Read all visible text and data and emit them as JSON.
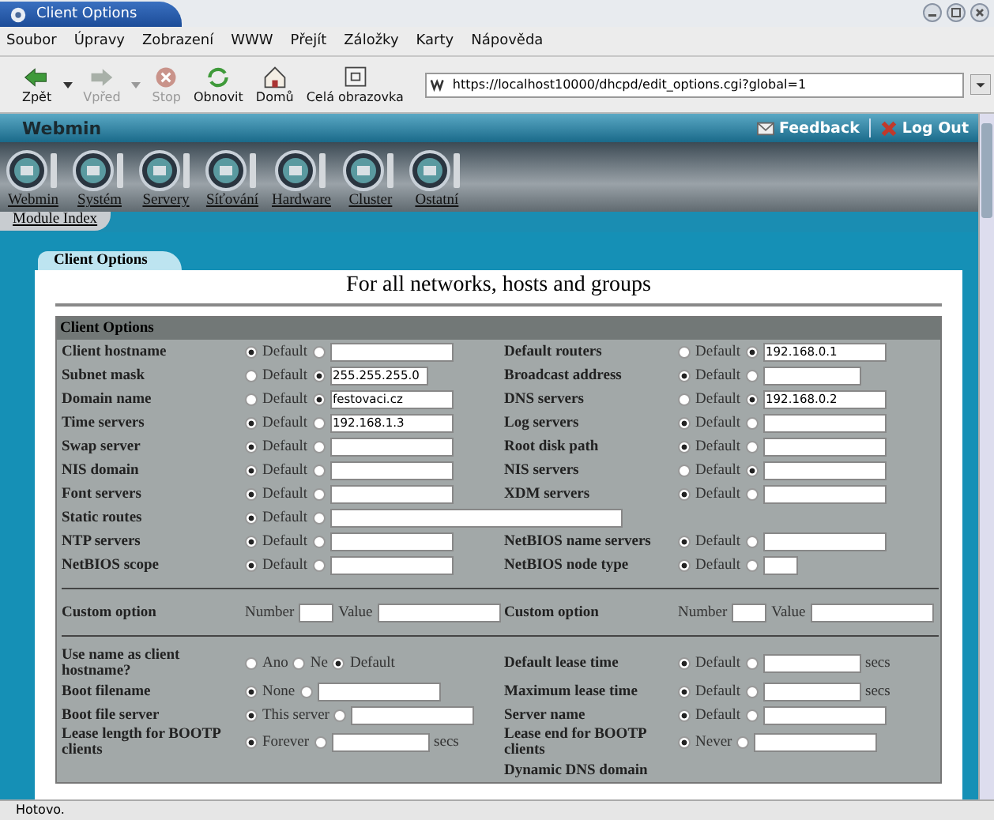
{
  "window": {
    "title": "Client Options"
  },
  "menu": [
    "Soubor",
    "Úpravy",
    "Zobrazení",
    "WWW",
    "Přejít",
    "Záložky",
    "Karty",
    "Nápověda"
  ],
  "toolbar": [
    {
      "label": "Zpět",
      "disabled": false,
      "dropdown": true
    },
    {
      "label": "Vpřed",
      "disabled": true,
      "dropdown": true
    },
    {
      "label": "Stop",
      "disabled": true,
      "dropdown": false
    },
    {
      "label": "Obnovit",
      "disabled": false,
      "dropdown": false
    },
    {
      "label": "Domů",
      "disabled": false,
      "dropdown": false
    },
    {
      "label": "Celá obrazovka",
      "disabled": false,
      "dropdown": false
    }
  ],
  "address": {
    "value": "https://localhost10000/dhcpd/edit_options.cgi?global=1"
  },
  "webmin": {
    "title": "Webmin",
    "feedback": "Feedback",
    "logout": "Log Out"
  },
  "categories": [
    "Webmin",
    "Systém",
    "Servery",
    "Síťování",
    "Hardware",
    "Cluster",
    "Ostatní"
  ],
  "module_index": "Module Index",
  "tab": "Client Options",
  "heading": "For all networks, hosts and groups",
  "section_title": "Client Options",
  "groups": [
    [
      {
        "left": {
          "label": "Client hostname",
          "controls": [
            {
              "kind": "radio",
              "label": "Default",
              "selected": true
            },
            {
              "kind": "radio",
              "selected": false
            },
            {
              "kind": "field"
            }
          ]
        },
        "right": {
          "label": "Default routers",
          "controls": [
            {
              "kind": "radio",
              "label": "Default",
              "selected": false
            },
            {
              "kind": "radio",
              "selected": true
            },
            {
              "kind": "field",
              "value": "192.168.0.1"
            }
          ]
        }
      },
      {
        "left": {
          "label": "Subnet mask",
          "controls": [
            {
              "kind": "radio",
              "label": "Default",
              "selected": false
            },
            {
              "kind": "radio",
              "selected": true
            },
            {
              "kind": "shortfield",
              "value": "255.255.255.0"
            }
          ]
        },
        "right": {
          "label": "Broadcast address",
          "controls": [
            {
              "kind": "radio",
              "label": "Default",
              "selected": true
            },
            {
              "kind": "radio",
              "selected": false
            },
            {
              "kind": "shortfield"
            }
          ]
        }
      },
      {
        "left": {
          "label": "Domain name",
          "controls": [
            {
              "kind": "radio",
              "label": "Default",
              "selected": false
            },
            {
              "kind": "radio",
              "selected": true
            },
            {
              "kind": "field",
              "value": "festovaci.cz"
            }
          ]
        },
        "right": {
          "label": "DNS servers",
          "controls": [
            {
              "kind": "radio",
              "label": "Default",
              "selected": false
            },
            {
              "kind": "radio",
              "selected": true
            },
            {
              "kind": "field",
              "value": "192.168.0.2"
            }
          ]
        }
      },
      {
        "left": {
          "label": "Time servers",
          "controls": [
            {
              "kind": "radio",
              "label": "Default",
              "selected": true
            },
            {
              "kind": "radio",
              "selected": false
            },
            {
              "kind": "field",
              "value": "192.168.1.3"
            }
          ]
        },
        "right": {
          "label": "Log servers",
          "controls": [
            {
              "kind": "radio",
              "label": "Default",
              "selected": true
            },
            {
              "kind": "radio",
              "selected": false
            },
            {
              "kind": "field"
            }
          ]
        }
      },
      {
        "left": {
          "label": "Swap server",
          "controls": [
            {
              "kind": "radio",
              "label": "Default",
              "selected": true
            },
            {
              "kind": "radio",
              "selected": false
            },
            {
              "kind": "field"
            }
          ]
        },
        "right": {
          "label": "Root disk path",
          "controls": [
            {
              "kind": "radio",
              "label": "Default",
              "selected": true
            },
            {
              "kind": "radio",
              "selected": false
            },
            {
              "kind": "field"
            }
          ]
        }
      },
      {
        "left": {
          "label": "NIS domain",
          "controls": [
            {
              "kind": "radio",
              "label": "Default",
              "selected": true
            },
            {
              "kind": "radio",
              "selected": false
            },
            {
              "kind": "field"
            }
          ]
        },
        "right": {
          "label": "NIS servers",
          "controls": [
            {
              "kind": "radio",
              "label": "Default",
              "selected": false
            },
            {
              "kind": "radio",
              "selected": true
            },
            {
              "kind": "field"
            }
          ]
        }
      },
      {
        "left": {
          "label": "Font servers",
          "controls": [
            {
              "kind": "radio",
              "label": "Default",
              "selected": true
            },
            {
              "kind": "radio",
              "selected": false
            },
            {
              "kind": "field"
            }
          ]
        },
        "right": {
          "label": "XDM servers",
          "controls": [
            {
              "kind": "radio",
              "label": "Default",
              "selected": true
            },
            {
              "kind": "radio",
              "selected": false
            },
            {
              "kind": "field"
            }
          ]
        }
      },
      {
        "left": {
          "label": "Static routes",
          "controls": [
            {
              "kind": "radio",
              "label": "Default",
              "selected": true
            },
            {
              "kind": "radio",
              "selected": false
            },
            {
              "kind": "widefield"
            }
          ]
        }
      },
      {
        "left": {
          "label": "NTP servers",
          "controls": [
            {
              "kind": "radio",
              "label": "Default",
              "selected": true
            },
            {
              "kind": "radio",
              "selected": false
            },
            {
              "kind": "field"
            }
          ]
        },
        "right": {
          "label": "NetBIOS name servers",
          "controls": [
            {
              "kind": "radio",
              "label": "Default",
              "selected": true
            },
            {
              "kind": "radio",
              "selected": false
            },
            {
              "kind": "field"
            }
          ]
        }
      },
      {
        "left": {
          "label": "NetBIOS scope",
          "controls": [
            {
              "kind": "radio",
              "label": "Default",
              "selected": true
            },
            {
              "kind": "radio",
              "selected": false
            },
            {
              "kind": "field"
            }
          ]
        },
        "right": {
          "label": "NetBIOS node type",
          "controls": [
            {
              "kind": "radio",
              "label": "Default",
              "selected": true
            },
            {
              "kind": "radio",
              "selected": false
            },
            {
              "kind": "tinyfield"
            }
          ]
        }
      }
    ],
    [
      {
        "left": {
          "label": "Custom option",
          "controls": [
            {
              "kind": "text",
              "text": "Number"
            },
            {
              "kind": "tinyfield"
            },
            {
              "kind": "text",
              "text": "Value"
            },
            {
              "kind": "field"
            }
          ]
        },
        "right": {
          "label": "Custom option",
          "controls": [
            {
              "kind": "text",
              "text": "Number"
            },
            {
              "kind": "tinyfield"
            },
            {
              "kind": "text",
              "text": "Value"
            },
            {
              "kind": "field"
            }
          ]
        }
      }
    ],
    [
      {
        "left": {
          "label": "Use name as client hostname?",
          "controls": [
            {
              "kind": "radio",
              "label": "Ano",
              "selected": false
            },
            {
              "kind": "radio",
              "label": "Ne",
              "selected": false
            },
            {
              "kind": "radio",
              "label": "Default",
              "selected": true
            }
          ]
        },
        "right": {
          "label": "Default lease time",
          "controls": [
            {
              "kind": "radio",
              "label": "Default",
              "selected": true
            },
            {
              "kind": "radio",
              "selected": false
            },
            {
              "kind": "shortfield"
            },
            {
              "kind": "text",
              "text": "secs"
            }
          ]
        }
      },
      {
        "left": {
          "label": "Boot filename",
          "controls": [
            {
              "kind": "radio",
              "label": "None",
              "selected": true
            },
            {
              "kind": "radio",
              "selected": false
            },
            {
              "kind": "field"
            }
          ]
        },
        "right": {
          "label": "Maximum lease time",
          "controls": [
            {
              "kind": "radio",
              "label": "Default",
              "selected": true
            },
            {
              "kind": "radio",
              "selected": false
            },
            {
              "kind": "shortfield"
            },
            {
              "kind": "text",
              "text": "secs"
            }
          ]
        }
      },
      {
        "left": {
          "label": "Boot file server",
          "controls": [
            {
              "kind": "radio",
              "label": "This server",
              "selected": true
            },
            {
              "kind": "radio",
              "selected": false
            },
            {
              "kind": "field"
            }
          ]
        },
        "right": {
          "label": "Server name",
          "controls": [
            {
              "kind": "radio",
              "label": "Default",
              "selected": true
            },
            {
              "kind": "radio",
              "selected": false
            },
            {
              "kind": "field"
            }
          ]
        }
      },
      {
        "left": {
          "label": "Lease length for BOOTP clients",
          "controls": [
            {
              "kind": "radio",
              "label": "Forever",
              "selected": true
            },
            {
              "kind": "radio",
              "selected": false
            },
            {
              "kind": "shortfield"
            },
            {
              "kind": "text",
              "text": "secs"
            }
          ]
        },
        "right": {
          "label": "Lease end for BOOTP clients",
          "controls": [
            {
              "kind": "radio",
              "label": "Never",
              "selected": true
            },
            {
              "kind": "radio",
              "selected": false
            },
            {
              "kind": "field"
            }
          ]
        }
      },
      {
        "right": {
          "label": "Dynamic DNS domain"
        }
      }
    ]
  ],
  "status": "Hotovo."
}
